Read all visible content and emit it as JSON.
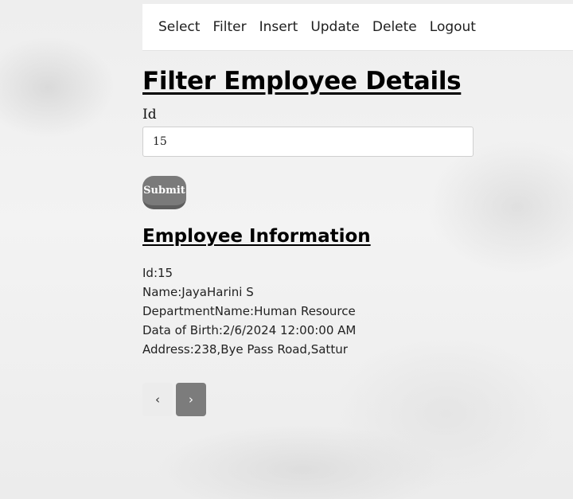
{
  "nav": {
    "items": [
      {
        "label": "Select"
      },
      {
        "label": "Filter"
      },
      {
        "label": "Insert"
      },
      {
        "label": "Update"
      },
      {
        "label": "Delete"
      },
      {
        "label": "Logout"
      }
    ]
  },
  "page": {
    "title": "Filter Employee Details"
  },
  "form": {
    "id_label": "Id",
    "id_value": "15",
    "submit_label": "Submit"
  },
  "info": {
    "title": "Employee Information",
    "lines": [
      "Id:15",
      "Name:JayaHarini S",
      "DepartmentName:Human Resource",
      "Data of Birth:2/6/2024 12:00:00 AM",
      "Address:238,Bye Pass Road,Sattur"
    ]
  },
  "pagination": {
    "prev": "‹",
    "next": "›"
  },
  "colors": {
    "submit_bg": "#7a7a7a",
    "active_page_bg": "#7c7c7c"
  }
}
